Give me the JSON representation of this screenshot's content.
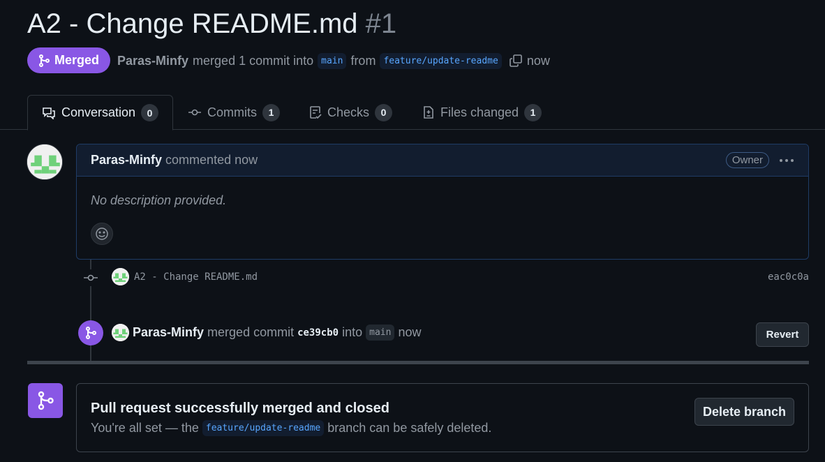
{
  "pr": {
    "title": "A2 - Change README.md",
    "number": "#1",
    "state": "Merged",
    "author": "Paras-Minfy",
    "merged_text": "merged 1 commit into",
    "base_branch": "main",
    "from_text": "from",
    "head_branch": "feature/update-readme",
    "time": "now"
  },
  "tabs": [
    {
      "label": "Conversation",
      "count": "0",
      "icon": "comment-discussion-icon"
    },
    {
      "label": "Commits",
      "count": "1",
      "icon": "git-commit-icon"
    },
    {
      "label": "Checks",
      "count": "0",
      "icon": "checklist-icon"
    },
    {
      "label": "Files changed",
      "count": "1",
      "icon": "file-diff-icon"
    }
  ],
  "comment": {
    "author": "Paras-Minfy",
    "when": "commented now",
    "role": "Owner",
    "body": "No description provided."
  },
  "commit": {
    "message": "A2 - Change README.md",
    "sha": "eac0c0a"
  },
  "merge_event": {
    "author": "Paras-Minfy",
    "text": "merged commit",
    "sha": "ce39cb0",
    "into": "into",
    "base": "main",
    "time": "now",
    "revert_label": "Revert"
  },
  "merge_box": {
    "title": "Pull request successfully merged and closed",
    "sub_prefix": "You're all set — the",
    "branch": "feature/update-readme",
    "sub_suffix": "branch can be safely deleted.",
    "delete_label": "Delete branch"
  },
  "colors": {
    "background": "#0d1117",
    "merged_purple": "#8957e5",
    "link_blue": "#58a6ff",
    "muted": "#9198a1"
  }
}
